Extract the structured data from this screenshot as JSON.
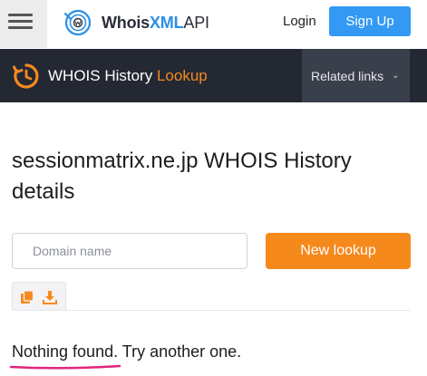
{
  "header": {
    "logo": {
      "part1": "Whois",
      "part2": "XML",
      "part3": "API"
    },
    "login_label": "Login",
    "signup_label": "Sign Up"
  },
  "toolbar": {
    "title_main": "WHOIS History",
    "title_accent": "Lookup",
    "related_label": "Related links"
  },
  "main": {
    "title": "sessionmatrix.ne.jp WHOIS History details",
    "search": {
      "placeholder": "Domain name",
      "value": ""
    },
    "button_label": "New lookup",
    "result_highlight": "Nothing found.",
    "result_rest": " Try another one."
  },
  "icons": {
    "menu": "hamburger-icon",
    "logo": "whoisxml-logo-icon",
    "history": "history-icon",
    "chevron": "chevron-down-icon",
    "copy": "copy-icon",
    "download": "download-icon"
  },
  "colors": {
    "brand_blue": "#3399f3",
    "accent_orange": "#f5891c",
    "toolbar_bg": "#242833",
    "highlight_pink": "#e0267a"
  }
}
